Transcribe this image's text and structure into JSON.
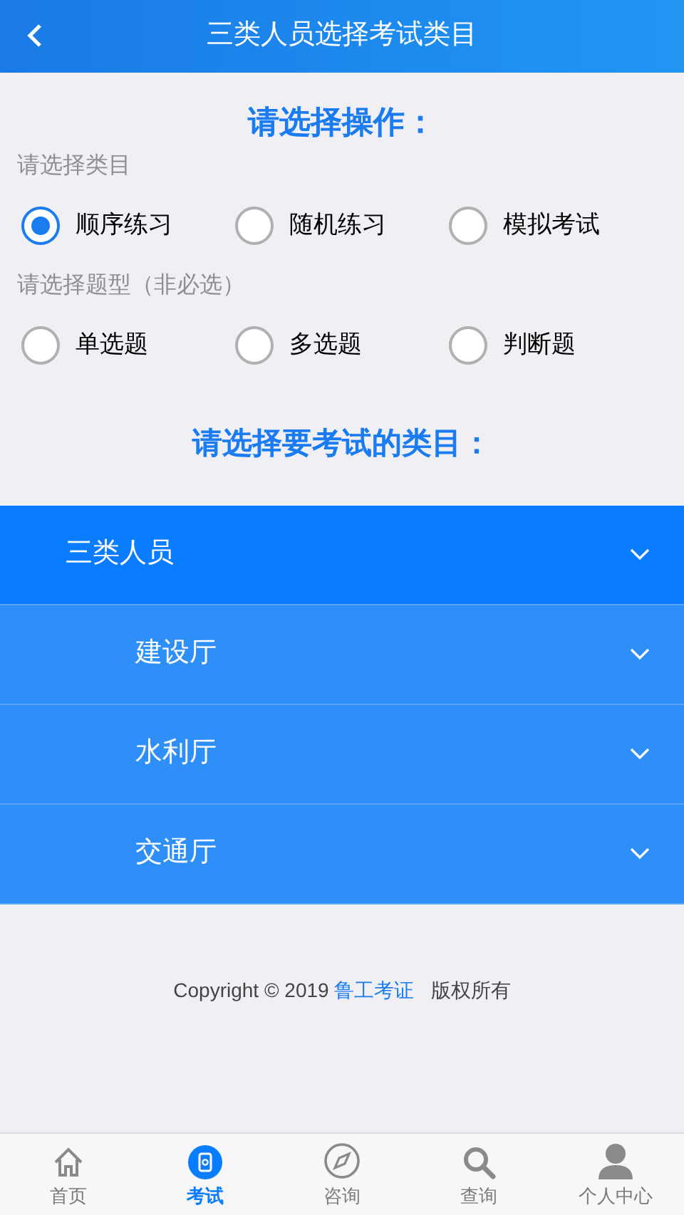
{
  "header": {
    "title": "三类人员选择考试类目"
  },
  "operation_heading": "请选择操作：",
  "groups": [
    {
      "label": "请选择类目",
      "options": [
        {
          "label": "顺序练习",
          "selected": true
        },
        {
          "label": "随机练习",
          "selected": false
        },
        {
          "label": "模拟考试",
          "selected": false
        }
      ]
    },
    {
      "label": "请选择题型（非必选）",
      "options": [
        {
          "label": "单选题",
          "selected": false
        },
        {
          "label": "多选题",
          "selected": false
        },
        {
          "label": "判断题",
          "selected": false
        }
      ]
    }
  ],
  "category_heading": "请选择要考试的类目：",
  "categories": [
    {
      "label": "三类人员",
      "children": [
        {
          "label": "建设厅"
        },
        {
          "label": "水利厅"
        },
        {
          "label": "交通厅"
        }
      ]
    }
  ],
  "footer": {
    "prefix": "Copyright © 2019",
    "brand": "鲁工考证",
    "suffix": "版权所有"
  },
  "tabs": [
    {
      "label": "首页",
      "kind": "home",
      "selected": false
    },
    {
      "label": "考试",
      "kind": "exam",
      "selected": true
    },
    {
      "label": "咨询",
      "kind": "compass",
      "selected": false
    },
    {
      "label": "查询",
      "kind": "search",
      "selected": false
    },
    {
      "label": "个人中心",
      "kind": "person",
      "selected": false
    }
  ]
}
